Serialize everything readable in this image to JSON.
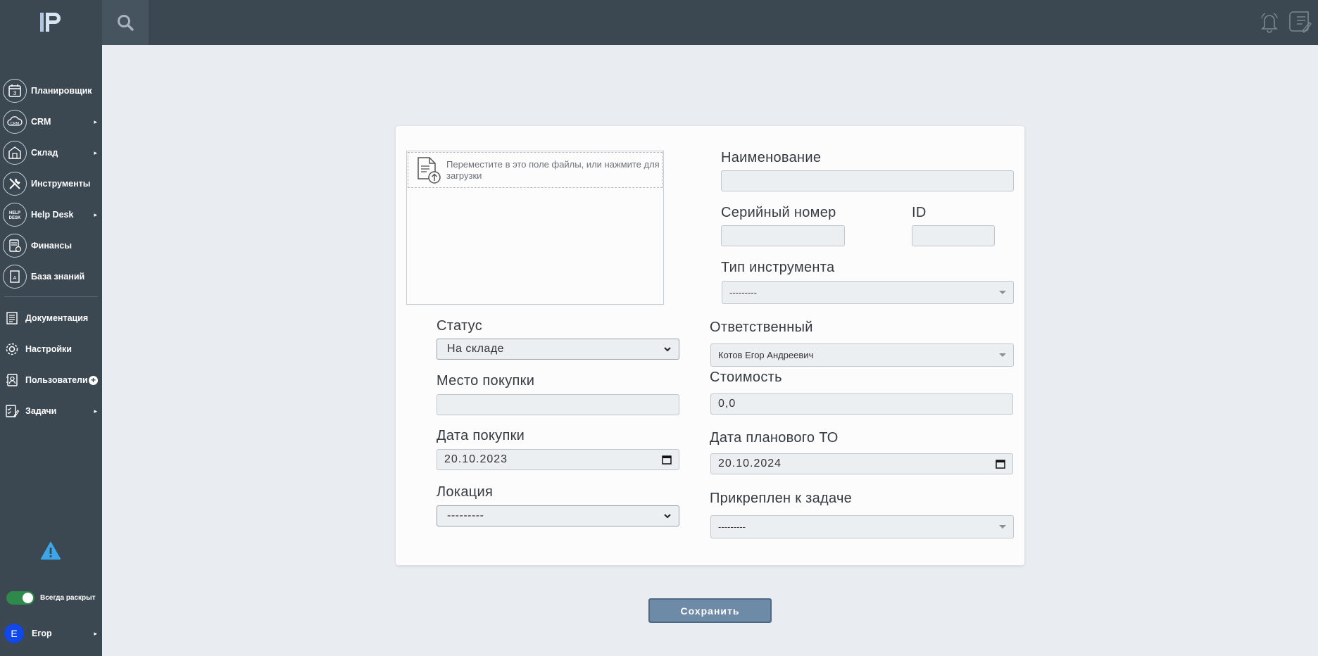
{
  "app": {
    "logo": "IP"
  },
  "sidebar": {
    "items": [
      {
        "label": "Планировщик",
        "icon": "calendar-icon",
        "arrow": ""
      },
      {
        "label": "CRM",
        "icon": "crm-cloud-icon",
        "arrow": "▸"
      },
      {
        "label": "Склад",
        "icon": "warehouse-icon",
        "arrow": "▸"
      },
      {
        "label": "Инструменты",
        "icon": "tools-icon",
        "arrow": ""
      },
      {
        "label": "Help Desk",
        "icon": "helpdesk-icon",
        "arrow": "▸"
      },
      {
        "label": "Финансы",
        "icon": "finance-icon",
        "arrow": ""
      },
      {
        "label": "База знаний",
        "icon": "knowledge-base-icon",
        "arrow": ""
      }
    ],
    "secondary": [
      {
        "label": "Документация",
        "icon": "documentation-icon"
      },
      {
        "label": "Настройки",
        "icon": "gear-icon"
      },
      {
        "label": "Пользователи",
        "icon": "users-icon",
        "plus": "+"
      },
      {
        "label": "Задачи",
        "icon": "tasks-icon",
        "arrow": "▸"
      }
    ],
    "toggle_label": "Всегда раскрыт",
    "toggle_on": true,
    "user": {
      "initial": "E",
      "name": "Егор",
      "arrow": "▸"
    }
  },
  "form": {
    "dropzone_text": "Переместите в это поле файлы, или нажмите для загрузки",
    "name_label": "Наименование",
    "name_value": "",
    "serial_label": "Серийный номер",
    "serial_value": "",
    "id_label": "ID",
    "id_value": "",
    "tool_type_label": "Тип инструмента",
    "tool_type_value": "---------",
    "status_label": "Статус",
    "status_value": "На складе",
    "responsible_label": "Ответственный",
    "responsible_value": "Котов Егор Андреевич",
    "purchase_place_label": "Место покупки",
    "purchase_place_value": "",
    "cost_label": "Стоимость",
    "cost_value": "0,0",
    "purchase_date_label": "Дата покупки",
    "purchase_date_value": "20.10.2023",
    "maintenance_date_label": "Дата планового ТО",
    "maintenance_date_value": "20.10.2024",
    "location_label": "Локация",
    "location_value": "---------",
    "task_label": "Прикреплен к задаче",
    "task_value": "---------"
  },
  "actions": {
    "save_label": "Сохранить"
  },
  "colors": {
    "sidebar": "#3b4852",
    "background": "#e9edf2",
    "save_button": "#6d8aa7",
    "toggle_on": "#2d8a4a",
    "avatar": "#1247e8",
    "warning": "#3ea6e8"
  }
}
